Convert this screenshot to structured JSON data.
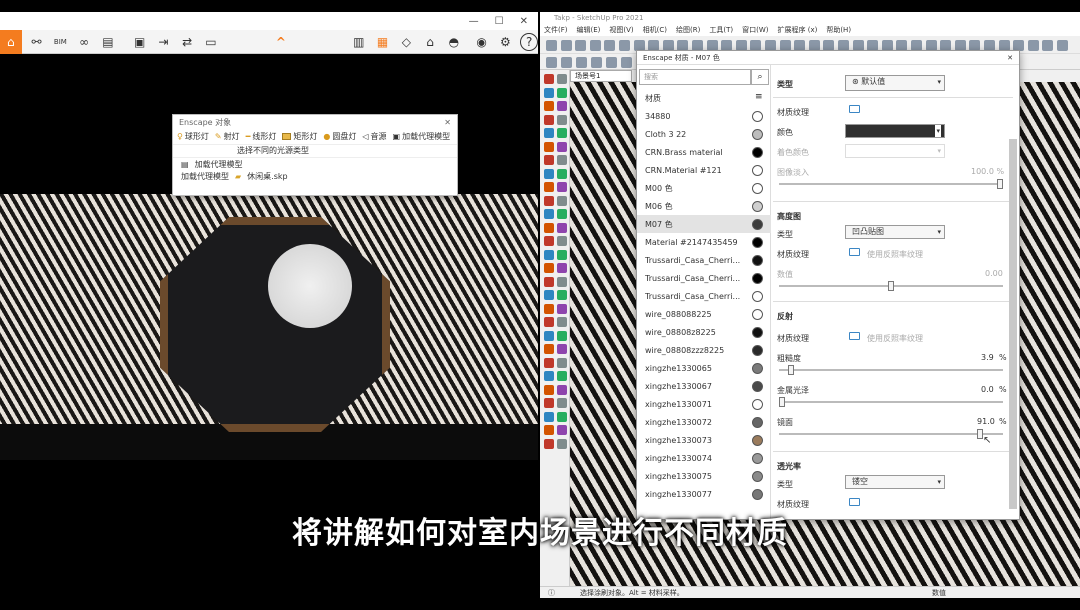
{
  "left_window": {
    "title_controls": [
      "—",
      "☐",
      "✕"
    ],
    "toolbar": {
      "bim_label": "BIM",
      "chevron": "^"
    }
  },
  "objects_dialog": {
    "title": "Enscape 对象",
    "tools": [
      "球形灯",
      "射灯",
      "线形灯",
      "矩形灯",
      "圆盘灯",
      "音源",
      "加载代理模型"
    ],
    "hint": "选择不同的光源类型",
    "section": "加载代理模型",
    "row_label": "加载代理模型",
    "file": "休闲桌.skp"
  },
  "sketchup": {
    "title": "Takp - SketchUp Pro 2021",
    "menu": [
      "文件(F)",
      "编辑(E)",
      "视图(V)",
      "相机(C)",
      "绘图(R)",
      "工具(T)",
      "窗口(W)",
      "扩展程序 (x)",
      "帮助(H)"
    ],
    "scene_tab": "场景号1",
    "status_text": "选择涂刷对象。Alt = 材料采样。",
    "status_value_label": "数值"
  },
  "materials_dialog": {
    "title": "Enscape 材质 - M07 色",
    "search_placeholder": "搜索",
    "list_header": "材质",
    "materials": [
      {
        "name": "34880",
        "color": "#ffffff"
      },
      {
        "name": "Cloth 3 22",
        "color": "#bdbdbd"
      },
      {
        "name": "CRN.Brass material",
        "color": "#000000"
      },
      {
        "name": "CRN.Material #121",
        "color": "#ffffff"
      },
      {
        "name": "M00 色",
        "color": "#ffffff"
      },
      {
        "name": "M06 色",
        "color": "#cfcfcf"
      },
      {
        "name": "M07 色",
        "color": "#3c3c3c",
        "selected": true
      },
      {
        "name": "Material #2147435459",
        "color": "#000000"
      },
      {
        "name": "Trussardi_Casa_Cherri...",
        "color": "#111111"
      },
      {
        "name": "Trussardi_Casa_Cherri...",
        "color": "#000000"
      },
      {
        "name": "Trussardi_Casa_Cherri...",
        "color": "#ffffff"
      },
      {
        "name": "wire_088088225",
        "color": "#ffffff"
      },
      {
        "name": "wire_08808z8225",
        "color": "#111111"
      },
      {
        "name": "wire_08808zzz8225",
        "color": "#2a2a2a"
      },
      {
        "name": "xingzhe1330065",
        "color": "#7a7a7a"
      },
      {
        "name": "xingzhe1330067",
        "color": "#4a4a4a"
      },
      {
        "name": "xingzhe1330071",
        "color": "#ffffff"
      },
      {
        "name": "xingzhe1330072",
        "color": "#666666"
      },
      {
        "name": "xingzhe1330073",
        "color": "#9a7b5c"
      },
      {
        "name": "xingzhe1330074",
        "color": "#999999"
      },
      {
        "name": "xingzhe1330075",
        "color": "#8a8a8a"
      },
      {
        "name": "xingzhe1330077",
        "color": "#777777"
      }
    ],
    "type_label": "类型",
    "type_value": "默认值",
    "albedo": {
      "texture_label": "材质纹理",
      "color_label": "颜色",
      "color_value": "#303030",
      "tint_label": "着色颜色",
      "image_fade_label": "图像淡入",
      "image_fade_value": "100.0 %",
      "image_fade_level": 1.0
    },
    "bump": {
      "header": "高度图",
      "type_label": "类型",
      "type_value": "凹凸贴图",
      "texture_label": "材质纹理",
      "texture_link": "使用反照率纹理",
      "amount_label": "数值",
      "amount_value": "0.00",
      "amount_level": 0.5
    },
    "reflection": {
      "header": "反射",
      "texture_label": "材质纹理",
      "texture_link": "使用反照率纹理",
      "roughness_label": "粗糙度",
      "roughness_value": "3.9",
      "metallic_label": "金属光泽",
      "metallic_value": "0.0",
      "specular_label": "镜面",
      "specular_value": "91.0",
      "percent": "%",
      "roughness_level": 0.039,
      "metallic_level": 0.0,
      "specular_level": 0.91
    },
    "transparency": {
      "header": "透光率",
      "type_label": "类型",
      "type_value": "镂空",
      "texture_label": "材质纹理"
    }
  },
  "subtitle": "将讲解如何对室内场景进行不同材质"
}
